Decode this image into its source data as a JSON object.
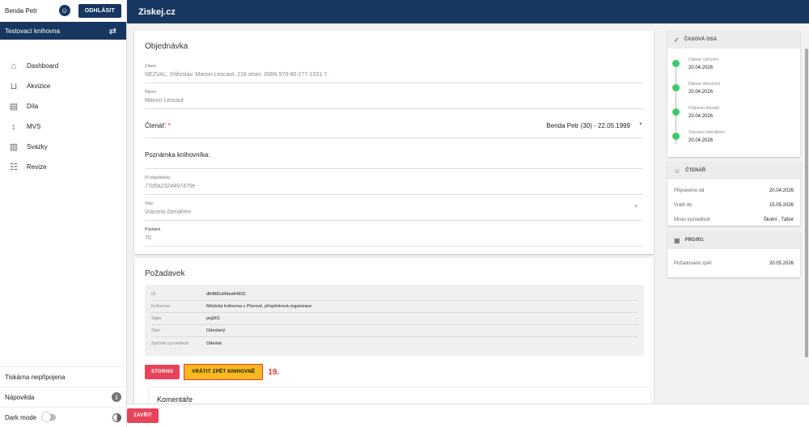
{
  "user": {
    "name": "Benda Petr",
    "logout_label": "ODHLÁSIT",
    "account_icon": "person-icon"
  },
  "library": {
    "name": "Testovací knihovna",
    "icon": "shuffle-icon"
  },
  "nav": [
    {
      "label": "Dashboard",
      "icon": "home-icon",
      "glyph": "⌂"
    },
    {
      "label": "Akvizice",
      "icon": "basket-icon",
      "glyph": "⊔"
    },
    {
      "label": "Díla",
      "icon": "book-icon",
      "glyph": "▤"
    },
    {
      "label": "MVS",
      "icon": "swap-vertical-icon",
      "glyph": "↕"
    },
    {
      "label": "Svazky",
      "icon": "library-icon",
      "glyph": "▥"
    },
    {
      "label": "Revize",
      "icon": "checklist-icon",
      "glyph": "☷"
    }
  ],
  "sidebar_bottom": {
    "printer": "Tiskárna nepřipojena",
    "help": "Nápověda",
    "dark_mode": "Dark mode"
  },
  "appbar": {
    "title": "Ziskej.cz"
  },
  "order": {
    "title": "Objednávka",
    "citation_label": "Citace",
    "citation_value": "NEZVAL, Vítězslav. Manon Lescaut. 218 stran. ISBN 978-80-277-1031-7.",
    "name_label": "Název",
    "name_value": "Manon Lescaut",
    "reader_label": "Čtenář:",
    "reader_required": "*",
    "reader_value": "Benda Petr (30) - 22.05.1999",
    "note_label": "Poznámka knihovníka:",
    "order_id_label": "ID objednávky",
    "order_id_value": "77d9a2324497470e",
    "state_label": "Stav",
    "state_value": "Vráceno čtenářem",
    "fee_label": "Poplatek",
    "fee_value": "70"
  },
  "request": {
    "title": "Požadavek",
    "rows": [
      {
        "key": "ID",
        "value": "d84881d49ed44831"
      },
      {
        "key": "Knihovna",
        "value": "Městská knihovna v Přerově, příspěvková organizace"
      },
      {
        "key": "Sigla",
        "value": "prg001"
      },
      {
        "key": "Stav",
        "value": "Odeslaný"
      },
      {
        "key": "Způsob vyzvednutí",
        "value": "Odeslat"
      }
    ],
    "cancel_label": "STORNO",
    "return_label": "VRÁTIT ZPĚT KNIHOVNĚ",
    "step_number": "19.",
    "comments_title": "Komentáře"
  },
  "timeline": {
    "title": "ČASOVÁ OSA",
    "items": [
      {
        "label": "Datum vyřízení",
        "date": "20.04.2026"
      },
      {
        "label": "Datum doručení",
        "date": "20.04.2026"
      },
      {
        "label": "Půjčeno čtenáři",
        "date": "20.04.2026"
      },
      {
        "label": "Vráceno čtenářem",
        "date": "20.04.2026"
      }
    ],
    "dot_color": "#3ccb6c"
  },
  "reader_panel": {
    "title": "ČTENÁŘ",
    "rows": [
      {
        "key": "Připraveno od",
        "value": "20.04.2026"
      },
      {
        "key": "Vrátit do",
        "value": "15.05.2026"
      },
      {
        "key": "Místo vyzvednutí",
        "value": "Školní , Tábor"
      }
    ]
  },
  "prg_panel": {
    "title": "PRG001",
    "rows": [
      {
        "key": "Požadováno zpět",
        "value": "20.05.2026"
      }
    ]
  },
  "bottom": {
    "close_label": "ZAVŘÍT"
  },
  "colors": {
    "primary": "#173660",
    "danger": "#e8435a",
    "warning": "#f9b81d",
    "success": "#3ccb6c"
  }
}
